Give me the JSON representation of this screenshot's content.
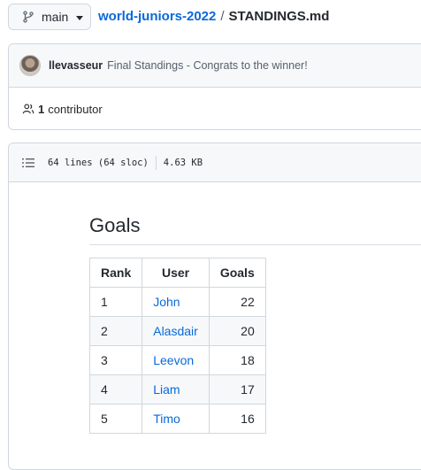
{
  "branch": {
    "label": "main",
    "icon": "git-branch-icon"
  },
  "breadcrumb": {
    "repo": "world-juniors-2022",
    "separator": "/",
    "file": "STANDINGS.md"
  },
  "commit": {
    "author": "llevasseur",
    "message": "Final Standings - Congrats to the winner!"
  },
  "contributors": {
    "count": "1",
    "label": "contributor"
  },
  "file_info": {
    "lines": "64 lines (64 sloc)",
    "size": "4.63 KB"
  },
  "markdown": {
    "heading": "Goals",
    "table": {
      "headers": [
        "Rank",
        "User",
        "Goals"
      ],
      "rows": [
        [
          "1",
          "John",
          "22"
        ],
        [
          "2",
          "Alasdair",
          "20"
        ],
        [
          "3",
          "Leevon",
          "18"
        ],
        [
          "4",
          "Liam",
          "17"
        ],
        [
          "5",
          "Timo",
          "16"
        ]
      ]
    }
  },
  "colors": {
    "link": "#0969da",
    "border": "#d0d7de",
    "header_bg": "#f6f8fa"
  }
}
